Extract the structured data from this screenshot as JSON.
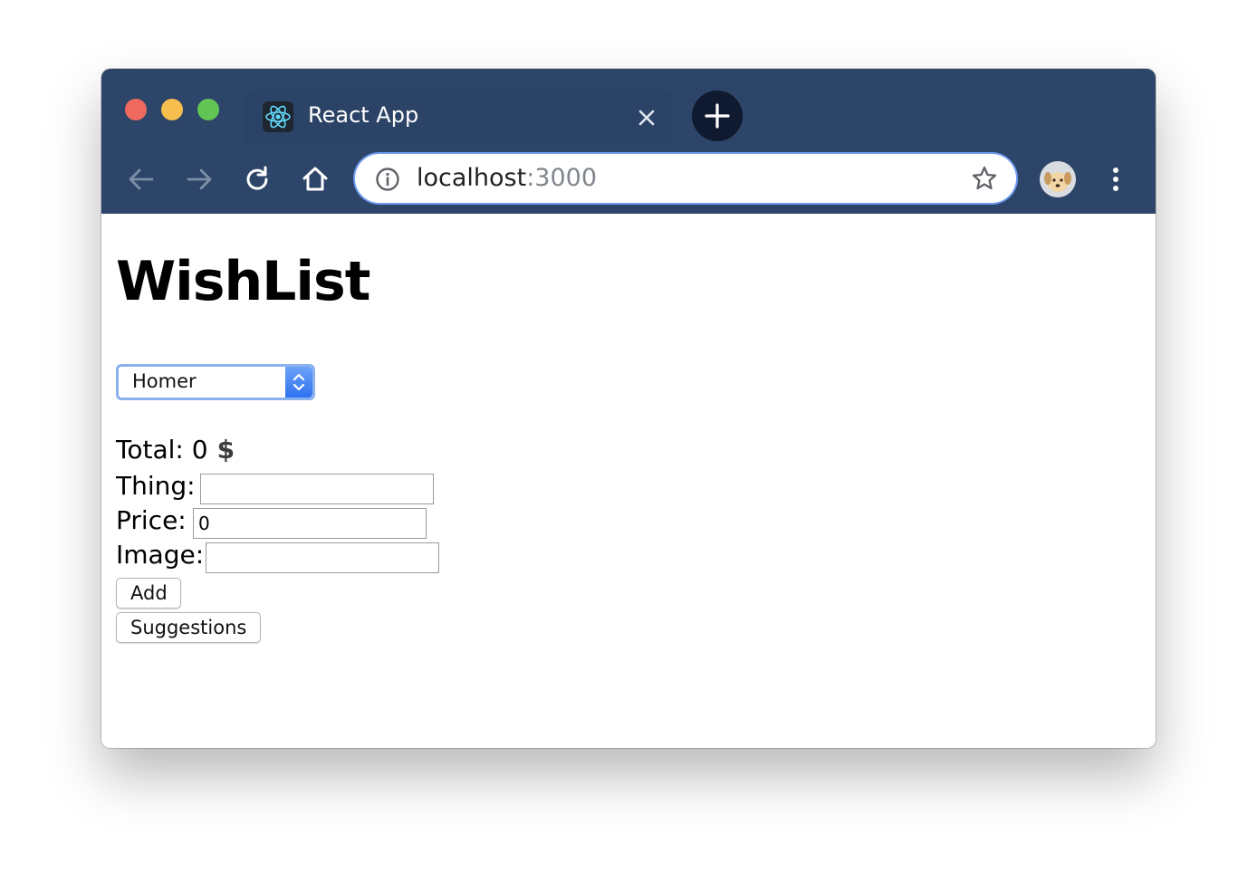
{
  "browser": {
    "tab": {
      "title": "React App",
      "favicon": "react-logo-icon"
    },
    "address_bar": {
      "host": "localhost",
      "port": ":3000"
    },
    "colors": {
      "frame": "#2d4568",
      "omnibox_focus": "#6f9bf0"
    }
  },
  "page": {
    "title": "WishList",
    "person_select": {
      "selected": "Homer"
    },
    "total": {
      "label": "Total:",
      "value": "0",
      "currency_icon": "dollar-icon"
    },
    "form": {
      "thing_label": "Thing:",
      "thing_value": "",
      "price_label": "Price:",
      "price_value": "0",
      "image_label": "Image:",
      "image_value": ""
    },
    "buttons": {
      "add_label": "Add",
      "suggestions_label": "Suggestions"
    }
  }
}
